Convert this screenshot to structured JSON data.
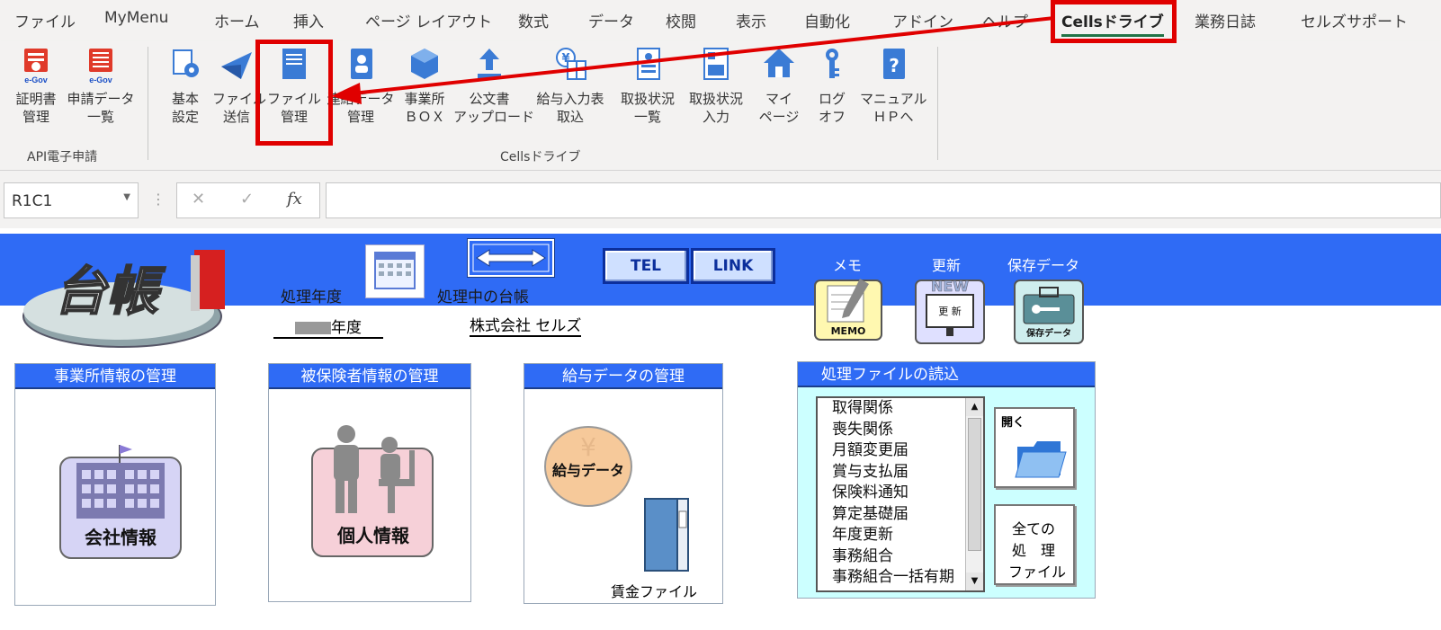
{
  "tabs": [
    "ファイル",
    "MyMenu",
    "ホーム",
    "挿入",
    "ページ レイアウト",
    "数式",
    "データ",
    "校閲",
    "表示",
    "自動化",
    "アドイン",
    "ヘルプ",
    "Cellsドライブ",
    "業務日誌",
    "セルズサポート"
  ],
  "active_tab": "Cellsドライブ",
  "ribbon": {
    "api_group": {
      "label": "API電子申請",
      "buttons": [
        {
          "label": "証明書\n管理",
          "icon": "e-gov-certificate-icon"
        },
        {
          "label": "申請データ\n一覧",
          "icon": "e-gov-list-icon"
        }
      ]
    },
    "cells_group": {
      "label": "Cellsドライブ",
      "buttons": [
        {
          "label": "基本\n設定",
          "icon": "settings-gear-icon"
        },
        {
          "label": "ファイル\n送信",
          "icon": "paper-plane-icon"
        },
        {
          "label": "ファイル\n管理",
          "icon": "file-folder-icon"
        },
        {
          "label": "連絡データ\n管理",
          "icon": "address-book-icon"
        },
        {
          "label": "事業所\nＢＯＸ",
          "icon": "cube-box-icon"
        },
        {
          "label": "公文書\nアップロード",
          "icon": "upload-icon"
        },
        {
          "label": "給与入力表\n取込",
          "icon": "yen-table-icon"
        },
        {
          "label": "取扱状況\n一覧",
          "icon": "status-list-icon"
        },
        {
          "label": "取扱状況\n入力",
          "icon": "status-input-icon"
        },
        {
          "label": "マイ\nページ",
          "icon": "home-icon"
        },
        {
          "label": "ログ\nオフ",
          "icon": "key-icon"
        },
        {
          "label": "マニュアル\nＨＰへ",
          "icon": "help-book-icon"
        }
      ]
    }
  },
  "formula_bar": {
    "name_box": "R1C1",
    "cancel": "✕",
    "enter": "✓",
    "fx": "fx",
    "value": ""
  },
  "sheet": {
    "logo_text": "台帳",
    "fiscal_year_label": "処理年度",
    "fiscal_year_value": "年度",
    "ledger_label": "処理中の台帳",
    "ledger_value": "株式会社 セルズ",
    "tel_button": "TEL",
    "link_button": "LINK",
    "memo_label": "メモ",
    "memo_icon_text": "MEMO",
    "update_label": "更新",
    "update_icon_text": "NEW",
    "update_icon_sub": "更 新",
    "saved_label": "保存データ",
    "saved_icon_text": "保存データ",
    "panels": {
      "office": {
        "title": "事業所情報の管理",
        "button": "会社情報"
      },
      "insured": {
        "title": "被保険者情報の管理",
        "button": "個人情報"
      },
      "salary": {
        "title": "給与データの管理",
        "button": "給与データ",
        "sub": "賃金ファイル"
      }
    },
    "file_panel": {
      "title": "処理ファイルの読込",
      "items": [
        "取得関係",
        "喪失関係",
        "月額変更届",
        "賞与支払届",
        "保険料通知",
        "算定基礎届",
        "年度更新",
        "事務組合",
        "事務組合一括有期"
      ],
      "open_button": "開く",
      "all_files_button": [
        "全ての",
        "処　理",
        "ファイル"
      ]
    }
  },
  "colors": {
    "accent_red": "#e00000",
    "header_blue": "#2f6bf5",
    "excel_green": "#217346",
    "file_panel_bg": "#ccffff"
  }
}
